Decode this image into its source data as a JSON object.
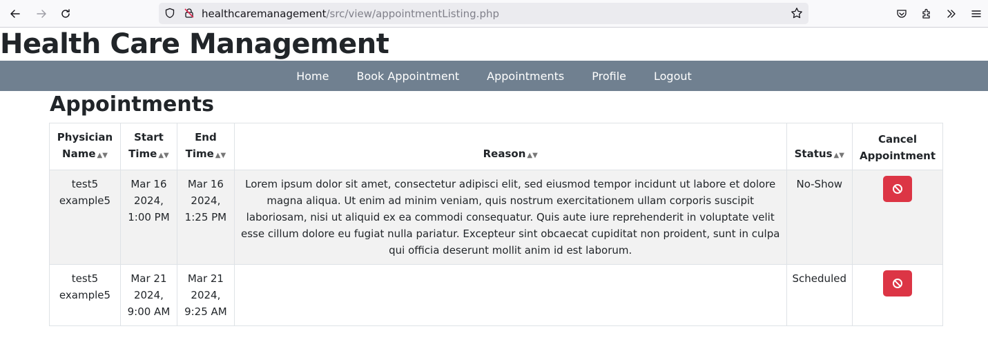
{
  "browser": {
    "url_host": "healthcaremanagement",
    "url_path": "/src/view/appointmentListing.php"
  },
  "site": {
    "title": "Health Care Management"
  },
  "nav": {
    "items": [
      {
        "label": "Home"
      },
      {
        "label": "Book Appointment"
      },
      {
        "label": "Appointments"
      },
      {
        "label": "Profile"
      },
      {
        "label": "Logout"
      }
    ]
  },
  "page": {
    "heading": "Appointments"
  },
  "table": {
    "headers": {
      "physician_line1": "Physician",
      "physician_line2": "Name",
      "start_line1": "Start",
      "start_line2": "Time",
      "end_line1": "End",
      "end_line2": "Time",
      "reason": "Reason",
      "status": "Status",
      "cancel_line1": "Cancel",
      "cancel_line2": "Appointment",
      "sort_glyph": "▲▼"
    },
    "rows": [
      {
        "physician_first": "test5",
        "physician_last": "example5",
        "start_date": "Mar 16",
        "start_year": "2024,",
        "start_time": "1:00 PM",
        "end_date": "Mar 16",
        "end_year": "2024,",
        "end_time": "1:25 PM",
        "reason": "Lorem ipsum dolor sit amet, consectetur adipisci elit, sed eiusmod tempor incidunt ut labore et dolore magna aliqua. Ut enim ad minim veniam, quis nostrum exercitationem ullam corporis suscipit laboriosam, nisi ut aliquid ex ea commodi consequatur. Quis aute iure reprehenderit in voluptate velit esse cillum dolore eu fugiat nulla pariatur. Excepteur sint obcaecat cupiditat non proident, sunt in culpa qui officia deserunt mollit anim id est laborum.",
        "status": "No-Show"
      },
      {
        "physician_first": "test5",
        "physician_last": "example5",
        "start_date": "Mar 21",
        "start_year": "2024,",
        "start_time": "9:00 AM",
        "end_date": "Mar 21",
        "end_year": "2024,",
        "end_time": "9:25 AM",
        "reason": "",
        "status": "Scheduled"
      }
    ]
  },
  "colors": {
    "navbar": "#708090",
    "cancel_button": "#dc3545",
    "striped_row": "#f2f2f2"
  },
  "icons": {
    "back": "back-arrow-icon",
    "forward": "forward-arrow-icon",
    "reload": "reload-icon",
    "shield": "shield-icon",
    "insecure": "insecure-lock-icon",
    "bookmark": "star-icon",
    "pocket": "pocket-icon",
    "extensions": "extensions-icon",
    "overflow": "chevrons-right-icon",
    "menu": "hamburger-menu-icon",
    "cancel": "ban-icon"
  }
}
